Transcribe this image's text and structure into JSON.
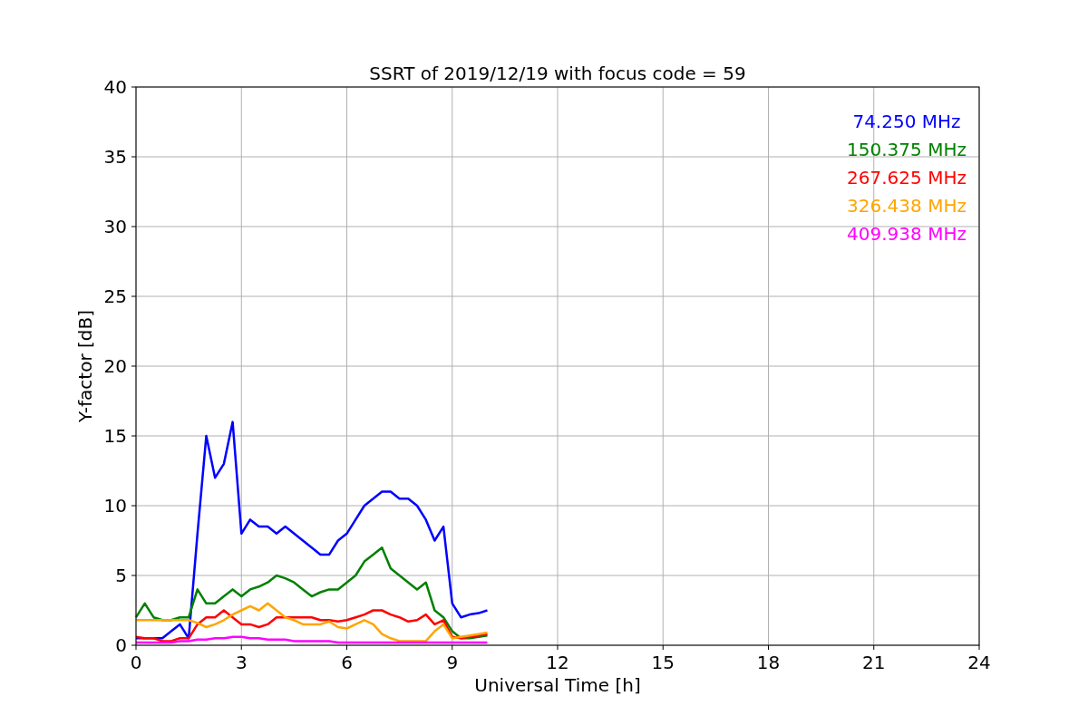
{
  "figure": {
    "chart_data": {
      "type": "line",
      "title": "SSRT of 2019/12/19 with focus code = 59",
      "xlabel": "Universal Time [h]",
      "ylabel": "Y-factor [dB]",
      "x": [
        0,
        0.25,
        0.5,
        0.75,
        1,
        1.25,
        1.5,
        1.75,
        2,
        2.25,
        2.5,
        2.75,
        3,
        3.25,
        3.5,
        3.75,
        4,
        4.25,
        4.5,
        4.75,
        5,
        5.25,
        5.5,
        5.75,
        6,
        6.25,
        6.5,
        6.75,
        7,
        7.25,
        7.5,
        7.75,
        8,
        8.25,
        8.5,
        8.75,
        9,
        9.25,
        9.5,
        9.75,
        10
      ],
      "series": [
        {
          "name": "74.250 MHz",
          "color": "#0000ff",
          "values": [
            0.5,
            0.5,
            0.5,
            0.5,
            1,
            1.5,
            0.5,
            8,
            15,
            12,
            13,
            16,
            8,
            9,
            8.5,
            8.5,
            8,
            8.5,
            8,
            7.5,
            7,
            6.5,
            6.5,
            7.5,
            8,
            9,
            10,
            10.5,
            11,
            11,
            10.5,
            10.5,
            10,
            9,
            7.5,
            8.5,
            3,
            2,
            2.2,
            2.3,
            2.5
          ]
        },
        {
          "name": "150.375 MHz",
          "color": "#008000",
          "values": [
            2,
            3,
            2,
            1.8,
            1.8,
            2,
            2,
            4,
            3,
            3,
            3.5,
            4,
            3.5,
            4,
            4.2,
            4.5,
            5,
            4.8,
            4.5,
            4,
            3.5,
            3.8,
            4,
            4,
            4.5,
            5,
            6,
            6.5,
            7,
            5.5,
            5,
            4.5,
            4,
            4.5,
            2.5,
            2,
            1,
            0.5,
            0.5,
            0.6,
            0.7
          ]
        },
        {
          "name": "267.625 MHz",
          "color": "#ff0000",
          "values": [
            0.6,
            0.5,
            0.5,
            0.3,
            0.3,
            0.5,
            0.5,
            1.5,
            2,
            2,
            2.5,
            2,
            1.5,
            1.5,
            1.3,
            1.5,
            2,
            2,
            2,
            2,
            2,
            1.8,
            1.8,
            1.7,
            1.8,
            2,
            2.2,
            2.5,
            2.5,
            2.2,
            2,
            1.7,
            1.8,
            2.2,
            1.5,
            1.8,
            0.6,
            0.5,
            0.6,
            0.7,
            0.8
          ]
        },
        {
          "name": "326.438 MHz",
          "color": "#ffa500",
          "values": [
            1.8,
            1.8,
            1.8,
            1.8,
            1.8,
            1.8,
            1.8,
            1.6,
            1.3,
            1.5,
            1.8,
            2.2,
            2.5,
            2.8,
            2.5,
            3,
            2.5,
            2,
            1.8,
            1.5,
            1.5,
            1.5,
            1.7,
            1.3,
            1.2,
            1.5,
            1.8,
            1.5,
            0.8,
            0.5,
            0.3,
            0.3,
            0.3,
            0.3,
            1,
            1.5,
            0.5,
            0.6,
            0.7,
            0.8,
            0.9
          ]
        },
        {
          "name": "409.938 MHz",
          "color": "#ff00ff",
          "values": [
            0.2,
            0.2,
            0.2,
            0.2,
            0.2,
            0.3,
            0.3,
            0.4,
            0.4,
            0.5,
            0.5,
            0.6,
            0.6,
            0.5,
            0.5,
            0.4,
            0.4,
            0.4,
            0.3,
            0.3,
            0.3,
            0.3,
            0.3,
            0.2,
            0.2,
            0.2,
            0.2,
            0.2,
            0.2,
            0.2,
            0.2,
            0.2,
            0.2,
            0.2,
            0.2,
            0.2,
            0.2,
            0.2,
            0.2,
            0.2,
            0.2
          ]
        }
      ],
      "xlim": [
        0,
        24
      ],
      "ylim": [
        0,
        40
      ],
      "xticks": [
        0,
        3,
        6,
        9,
        12,
        15,
        18,
        21,
        24
      ],
      "yticks": [
        0,
        5,
        10,
        15,
        20,
        25,
        30,
        35,
        40
      ],
      "grid": true
    }
  }
}
